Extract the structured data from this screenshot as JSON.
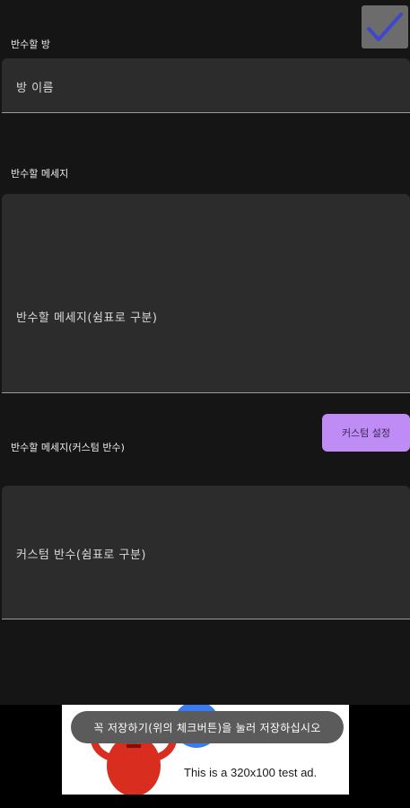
{
  "header": {
    "save_icon": "check-icon"
  },
  "room": {
    "label": "반수할 방",
    "placeholder": "방 이름"
  },
  "message": {
    "label": "반수할 메세지",
    "placeholder": "반수할 메세지(쉼표로 구분)"
  },
  "custom": {
    "label": "반수할 메세지(커스텀 반수)",
    "button_label": "커스텀 설정",
    "placeholder": "커스텀 반수(쉼표로 구분)"
  },
  "ad": {
    "text": "This is a 320x100 test ad."
  },
  "toast": {
    "text": "꼭 저장하기(위의 체크버튼)을 눌러 저장하십시오"
  },
  "colors": {
    "background": "#151515",
    "field": "#2c2c2c",
    "accent_button": "#bf8bf4",
    "check": "#3f48cc"
  }
}
